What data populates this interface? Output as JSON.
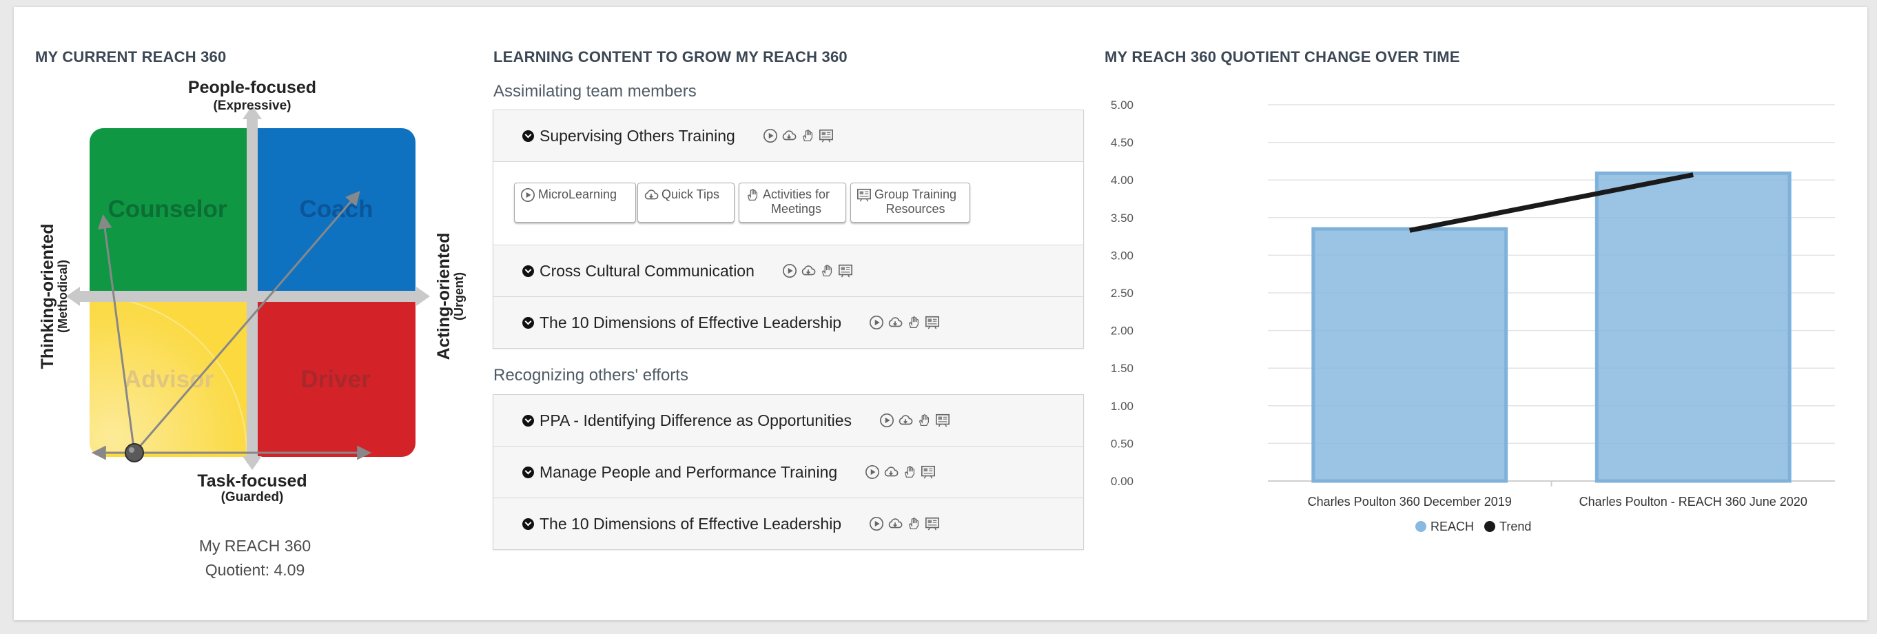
{
  "left": {
    "title": "MY CURRENT REACH 360",
    "axis_top": "People-focused",
    "axis_top_sub": "(Expressive)",
    "axis_bottom": "Task-focused",
    "axis_bottom_sub": "(Guarded)",
    "axis_left": "Thinking-oriented",
    "axis_left_sub": "(Methodical)",
    "axis_right": "Acting-oriented",
    "axis_right_sub": "(Urgent)",
    "quadrants": [
      "Counselor",
      "Coach",
      "Advisor",
      "Driver"
    ],
    "quotient_line1": "My REACH 360",
    "quotient_line2": "Quotient: 4.09",
    "colors": {
      "counselor": "#0f9744",
      "coach": "#0f72c0",
      "advisor": "#fbd93f",
      "driver": "#d42229"
    }
  },
  "middle": {
    "title": "LEARNING CONTENT TO GROW MY REACH 360",
    "groups": [
      {
        "heading": "Assimilating team members",
        "items": [
          {
            "label": "Supervising Others Training",
            "expanded": true
          },
          {
            "label": "Cross Cultural Communication"
          },
          {
            "label": "The 10 Dimensions of Effective Leadership"
          }
        ]
      },
      {
        "heading": "Recognizing others' efforts",
        "items": [
          {
            "label": "PPA - Identifying Difference as Opportunities"
          },
          {
            "label": "Manage People and Performance Training"
          },
          {
            "label": "The 10 Dimensions of Effective Leadership"
          }
        ]
      }
    ],
    "buttons": [
      {
        "line1": "MicroLearning",
        "line2": "",
        "icon": "play-icon"
      },
      {
        "line1": "Quick Tips",
        "line2": "",
        "icon": "cloud-download-icon"
      },
      {
        "line1": "Activities for",
        "line2": "Meetings",
        "icon": "hand-icon"
      },
      {
        "line1": "Group Training",
        "line2": "Resources",
        "icon": "slideshow-icon"
      }
    ],
    "item_icons": [
      "play-icon",
      "cloud-download-icon",
      "hand-icon",
      "slideshow-icon"
    ]
  },
  "right": {
    "title": "MY REACH 360 QUOTIENT CHANGE OVER TIME"
  },
  "chart_data": {
    "type": "bar",
    "categories": [
      "Charles Poulton 360 December 2019",
      "Charles Poulton - REACH 360 June 2020"
    ],
    "series": [
      {
        "name": "REACH",
        "type": "bar",
        "values": [
          3.35,
          4.09
        ],
        "color": "#88b9df"
      },
      {
        "name": "Trend",
        "type": "line",
        "values": [
          3.33,
          4.07
        ],
        "color": "#1a1a1a"
      }
    ],
    "ylim": [
      0,
      5
    ],
    "yticks": [
      "0.00",
      "0.50",
      "1.00",
      "1.50",
      "2.00",
      "2.50",
      "3.00",
      "3.50",
      "4.00",
      "4.50",
      "5.00"
    ],
    "legend": [
      "REACH",
      "Trend"
    ],
    "legend_position": "bottom",
    "grid": true
  }
}
